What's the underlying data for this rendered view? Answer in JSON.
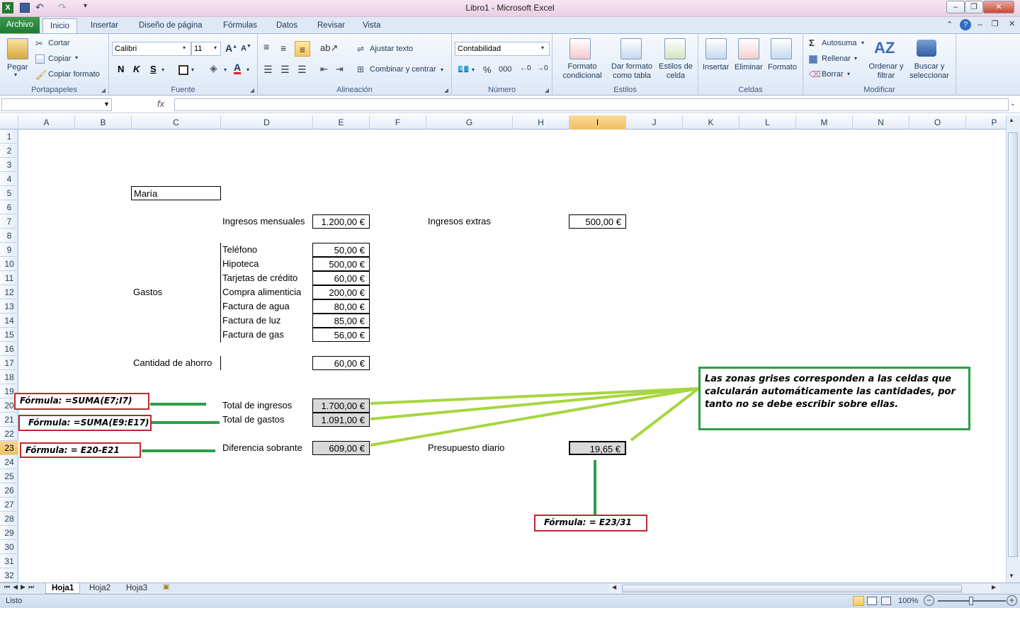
{
  "window": {
    "title": "Libro1  -  Microsoft Excel"
  },
  "tabs": {
    "archivo": "Archivo",
    "items": [
      "Inicio",
      "Insertar",
      "Diseño de página",
      "Fórmulas",
      "Datos",
      "Revisar",
      "Vista"
    ]
  },
  "ribbon": {
    "portapapeles": {
      "label": "Portapapeles",
      "pegar": "Pegar",
      "cortar": "Cortar",
      "copiar": "Copiar",
      "copiar_formato": "Copiar formato"
    },
    "fuente": {
      "label": "Fuente",
      "font": "Calibri",
      "size": "11",
      "bold": "N",
      "italic": "K",
      "underline": "S"
    },
    "alineacion": {
      "label": "Alineación",
      "ajustar": "Ajustar texto",
      "combinar": "Combinar y centrar"
    },
    "numero": {
      "label": "Número",
      "format": "Contabilidad",
      "percent": "%",
      "thousands": "000"
    },
    "estilos": {
      "label": "Estilos",
      "formato_condicional": "Formato condicional",
      "dar_formato": "Dar formato como tabla",
      "estilos_celda": "Estilos de celda"
    },
    "celdas": {
      "label": "Celdas",
      "insertar": "Insertar",
      "eliminar": "Eliminar",
      "formato": "Formato"
    },
    "modificar": {
      "label": "Modificar",
      "autosuma": "Autosuma",
      "rellenar": "Rellenar",
      "borrar": "Borrar",
      "ordenar": "Ordenar y filtrar",
      "buscar": "Buscar y seleccionar"
    }
  },
  "formula_bar": {
    "fx": "fx",
    "name": "",
    "content": ""
  },
  "columns": [
    "A",
    "B",
    "C",
    "D",
    "E",
    "F",
    "G",
    "H",
    "I",
    "J",
    "K",
    "L",
    "M",
    "N",
    "O",
    "P"
  ],
  "selected_column": "I",
  "selected_row": "23",
  "rows": [
    "1",
    "2",
    "3",
    "4",
    "5",
    "6",
    "7",
    "8",
    "9",
    "10",
    "11",
    "12",
    "13",
    "14",
    "15",
    "16",
    "17",
    "18",
    "19",
    "20",
    "21",
    "22",
    "23",
    "24",
    "25",
    "26",
    "27",
    "28",
    "29",
    "30",
    "31",
    "32"
  ],
  "sheet": {
    "name": "María",
    "ingresos_mensuales_label": "Ingresos mensuales",
    "ingresos_mensuales": "1.200,00 €",
    "ingresos_extras_label": "Ingresos extras",
    "ingresos_extras": "500,00 €",
    "gastos_label": "Gastos",
    "gastos": [
      {
        "label": "Teléfono",
        "value": "50,00 €"
      },
      {
        "label": "Hipoteca",
        "value": "500,00 €"
      },
      {
        "label": "Tarjetas de crédito",
        "value": "60,00 €"
      },
      {
        "label": "Compra alimenticia",
        "value": "200,00 €"
      },
      {
        "label": "Factura de agua",
        "value": "80,00 €"
      },
      {
        "label": "Factura de luz",
        "value": "85,00 €"
      },
      {
        "label": "Factura de gas",
        "value": "56,00 €"
      }
    ],
    "ahorro_label": "Cantidad de ahorro",
    "ahorro": "60,00 €",
    "total_ingresos_label": "Total de ingresos",
    "total_ingresos": "1.700,00 €",
    "total_gastos_label": "Total de gastos",
    "total_gastos": "1.091,00 €",
    "diferencia_label": "Diferencia sobrante",
    "diferencia": "609,00 €",
    "presupuesto_label": "Presupuesto diario",
    "presupuesto": "19,65 €"
  },
  "annotations": {
    "f1": "Fórmula: =SUMA(E7;I7)",
    "f2": "Fórmula: =SUMA(E9:E17)",
    "f3": "Fórmula: = E20-E21",
    "f4": "Fórmula: = E23/31",
    "note": "Las zonas grises corresponden a las celdas que calcularán automáticamente las cantidades, por tanto no se debe escribir sobre ellas.",
    "line_color_green": "#2e9e48",
    "line_color_lime": "#a6d640",
    "box_color_red": "#c0272d"
  },
  "sheets": [
    "Hoja1",
    "Hoja2",
    "Hoja3"
  ],
  "status": {
    "ready": "Listo",
    "zoom": "100%"
  }
}
